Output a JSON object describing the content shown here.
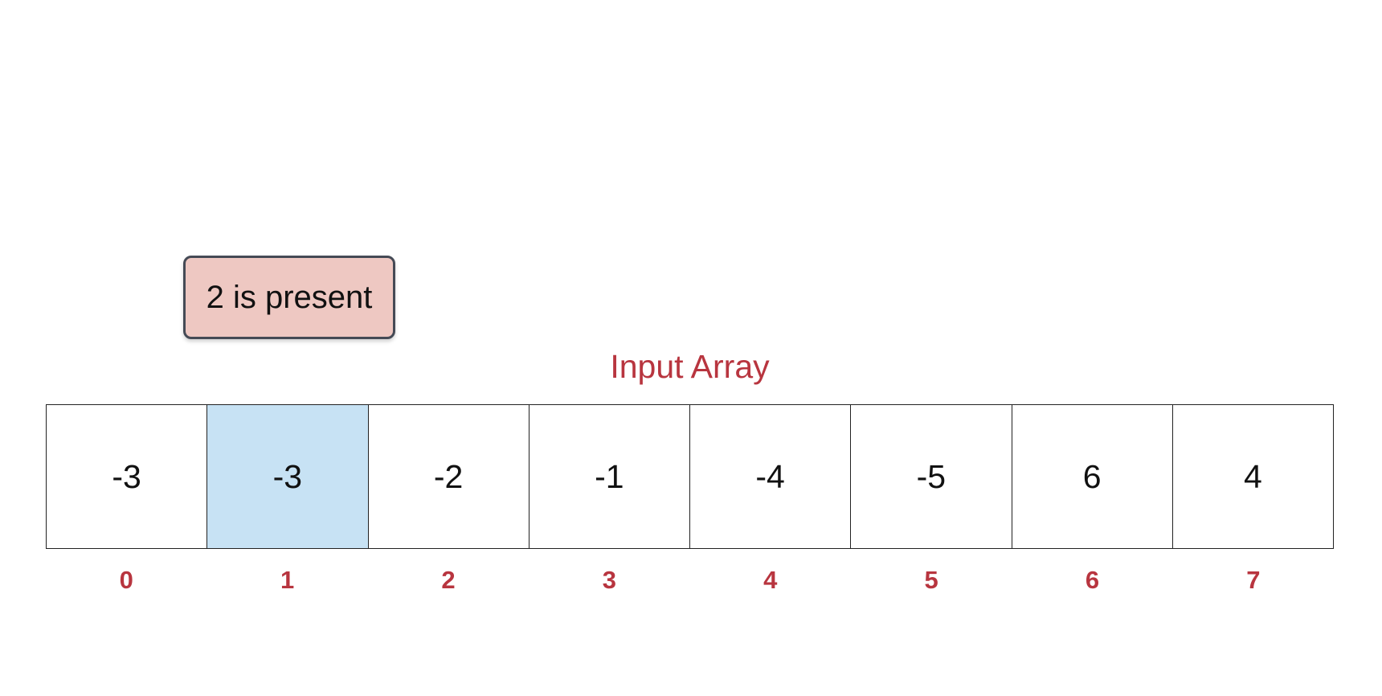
{
  "callout": {
    "text": "2 is present",
    "fill_color": "#eec8c2",
    "border_color": "#454a55"
  },
  "array": {
    "title": "Input Array",
    "title_color": "#b8353f",
    "highlight_color": "#c7e2f4",
    "highlighted_index": 1,
    "cells": [
      {
        "value": "-3",
        "index": "0"
      },
      {
        "value": "-3",
        "index": "1"
      },
      {
        "value": "-2",
        "index": "2"
      },
      {
        "value": "-1",
        "index": "3"
      },
      {
        "value": "-4",
        "index": "4"
      },
      {
        "value": "-5",
        "index": "5"
      },
      {
        "value": "6",
        "index": "6"
      },
      {
        "value": "4",
        "index": "7"
      }
    ]
  }
}
